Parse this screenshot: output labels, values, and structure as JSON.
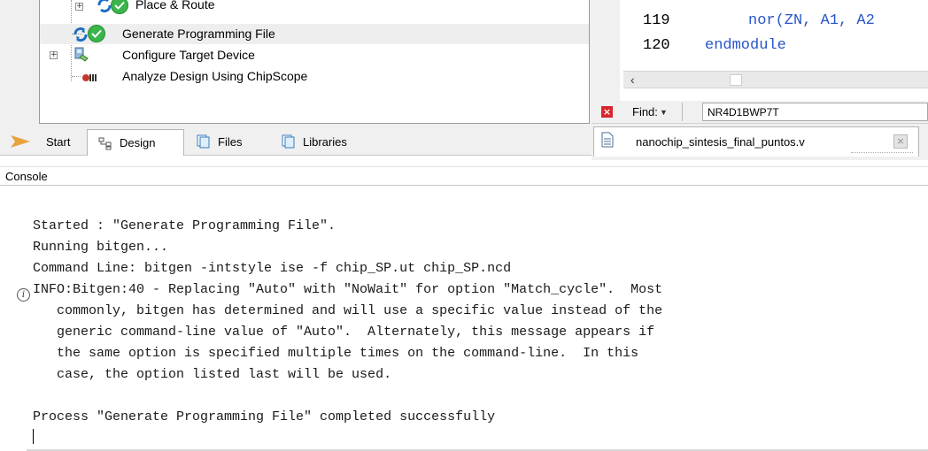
{
  "process_tree": {
    "items": [
      {
        "label": "Place & Route",
        "status": "done"
      },
      {
        "label": "Generate Programming File",
        "status": "done"
      },
      {
        "label": "Configure Target Device",
        "status": "idle"
      },
      {
        "label": "Analyze Design Using ChipScope",
        "status": "idle"
      }
    ]
  },
  "left_tabs": {
    "tabs": [
      {
        "label": "Start"
      },
      {
        "label": "Design"
      },
      {
        "label": "Files"
      },
      {
        "label": "Libraries"
      }
    ],
    "active": "Design"
  },
  "editor": {
    "lines": [
      {
        "number": "119",
        "code": "nor(ZN, A1, A2"
      },
      {
        "number": "120",
        "code": "endmodule"
      }
    ]
  },
  "find_bar": {
    "label": "Find:",
    "value": "NR4D1BWP7T"
  },
  "file_tab": {
    "filename": "nanochip_sintesis_final_puntos.v"
  },
  "console": {
    "title": "Console",
    "lines": [
      "Started : \"Generate Programming File\".",
      "Running bitgen...",
      "Command Line: bitgen -intstyle ise -f chip_SP.ut chip_SP.ncd",
      "INFO:Bitgen:40 - Replacing \"Auto\" with \"NoWait\" for option \"Match_cycle\".  Most",
      "   commonly, bitgen has determined and will use a specific value instead of the",
      "   generic command-line value of \"Auto\".  Alternately, this message appears if",
      "   the same option is specified multiple times on the command-line.  In this",
      "   case, the option listed last will be used.",
      "",
      "Process \"Generate Programming File\" completed successfully"
    ]
  },
  "colors": {
    "keyword": "#2a55c9",
    "success": "#39b54a",
    "close_red": "#d9262c"
  }
}
